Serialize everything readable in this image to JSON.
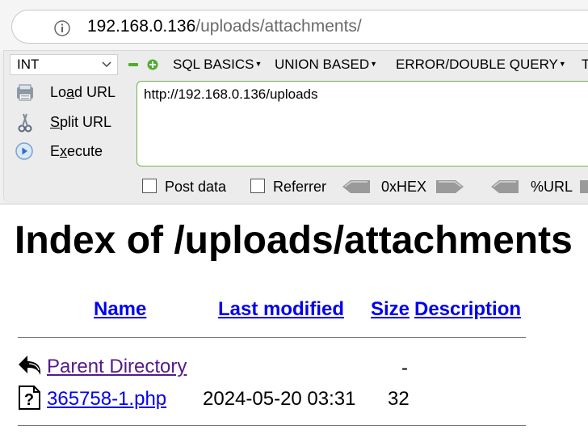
{
  "browser": {
    "url_host": "192.168.0.136",
    "url_path": "/uploads/attachments/"
  },
  "hackbar": {
    "type_select": "INT",
    "menus": [
      "SQL BASICS",
      "UNION BASED",
      "ERROR/DOUBLE QUERY",
      "T"
    ],
    "load_url_prefix": "Lo",
    "load_url_underline": "a",
    "load_url_suffix": "d URL",
    "split_url_prefix": "",
    "split_url_underline": "S",
    "split_url_suffix": "plit URL",
    "execute_prefix": "E",
    "execute_underline": "x",
    "execute_suffix": "ecute",
    "query": "http://192.168.0.136/uploads",
    "post_data_label": "Post data",
    "referrer_label": "Referrer",
    "hex_label": "0xHEX",
    "url_label": "%URL"
  },
  "page": {
    "title": "Index of /uploads/attachments",
    "columns": {
      "name": "Name",
      "last_modified": "Last modified",
      "size": "Size",
      "description": "Description"
    },
    "parent": {
      "name": "Parent Directory",
      "size": "-"
    },
    "files": [
      {
        "name": "365758-1.php",
        "last_modified": "2024-05-20 03:31",
        "size": "32"
      }
    ]
  }
}
